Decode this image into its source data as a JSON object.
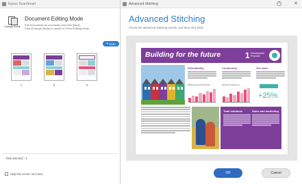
{
  "left_window": {
    "title": "Epson ScanSmart",
    "mode_button_label": "Change Mode",
    "mode_title": "Document Editing Mode",
    "mode_desc_line1": "Edit documents as necessary and click [Next].",
    "mode_desc_line2": "Click [Change Mode] to switch to Photo Editing Mode.",
    "scan_button_label": "Scan",
    "thumbnails": [
      "1",
      "2",
      "2"
    ],
    "total_label": "Total selected : 3",
    "skip_label": "Skip this screen next time."
  },
  "dialog": {
    "title": "Advanced Stitching",
    "heading": "Advanced Stitching",
    "subtitle": "Check the advanced stitching results, and then click [OK].",
    "ok_label": "OK",
    "cancel_label": "Cancel"
  },
  "preview_doc": {
    "banner_title": "Building for the future",
    "banner_number": "1",
    "banner_label_line1": "Development",
    "banner_label_line2": "Proposal",
    "col1_head": "Affordability",
    "col2_head": "Community",
    "col3_head": "Our aims",
    "chart1_title": "Building growth this year",
    "chart2_title": "Monthly projections",
    "stat_value": "+25%",
    "bottom_head1": "Total solutions",
    "bottom_head2": "Sales and marketing"
  },
  "colors": {
    "accent_blue": "#2e7ec8",
    "ok_button": "#2f6cc1",
    "banner_purple": "#7d3f9a",
    "teal": "#3fb3a8",
    "chart_pink": "#e8507a",
    "house_colors": [
      "#2a6fb0",
      "#c8323c",
      "#7d3f9a",
      "#e0b32e",
      "#3fa86a"
    ]
  },
  "chart_bars": {
    "chart1": [
      0.3,
      0.45,
      0.38,
      0.6,
      0.52,
      0.75,
      0.68,
      0.9
    ],
    "chart2": [
      0.4,
      0.35,
      0.55,
      0.5,
      0.7,
      0.62,
      0.85,
      0.95
    ]
  },
  "icons": {
    "app": "app-icon",
    "help": "help-icon",
    "close": "close-icon",
    "mode": "document-mode-icon"
  }
}
